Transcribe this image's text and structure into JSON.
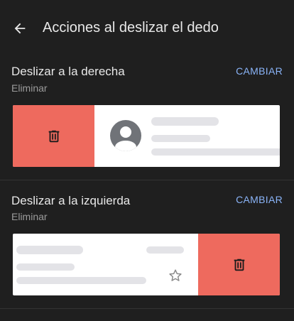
{
  "header": {
    "title": "Acciones al deslizar el dedo",
    "back_icon": "arrow-back-icon"
  },
  "sections": [
    {
      "title": "Deslizar a la derecha",
      "action": "Eliminar",
      "change_label": "CAMBIAR",
      "icon": "trash-icon"
    },
    {
      "title": "Deslizar a la izquierda",
      "action": "Eliminar",
      "change_label": "CAMBIAR",
      "icon": "trash-icon"
    }
  ],
  "colors": {
    "background": "#1f1f1f",
    "action": "#ee6a5e",
    "accent": "#8ab4f8",
    "placeholder": "#e3e3e7",
    "avatar": "#707378"
  }
}
